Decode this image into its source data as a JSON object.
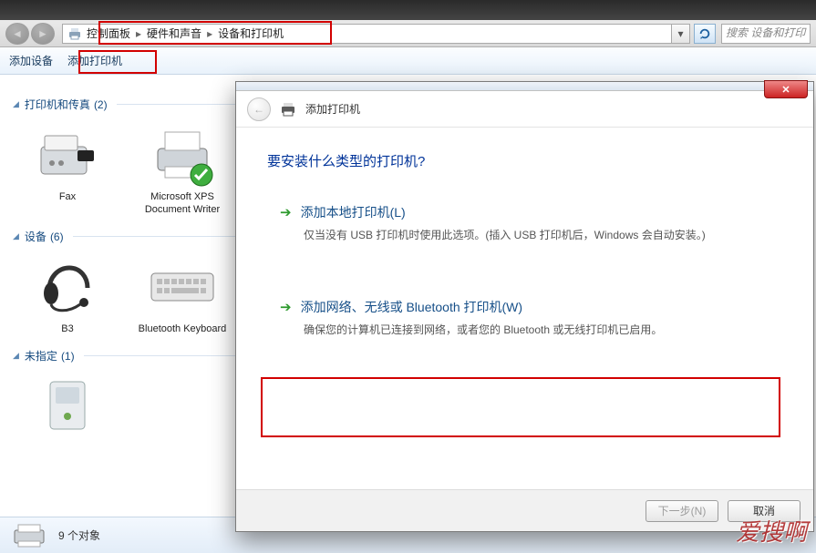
{
  "title_bar": "",
  "breadcrumb": {
    "items": [
      "控制面板",
      "硬件和声音",
      "设备和打印机"
    ]
  },
  "search": {
    "placeholder": "搜索 设备和打印"
  },
  "command_bar": {
    "add_device": "添加设备",
    "add_printer": "添加打印机"
  },
  "groups": {
    "printers": {
      "title": "打印机和传真",
      "count": "(2)"
    },
    "devices": {
      "title": "设备",
      "count": "(6)"
    },
    "unspecified": {
      "title": "未指定",
      "count": "(1)"
    }
  },
  "printers_items": [
    {
      "label": "Fax"
    },
    {
      "label": "Microsoft XPS Document Writer"
    }
  ],
  "devices_items": [
    {
      "label": "B3"
    },
    {
      "label": "Bluetooth Keyboard"
    }
  ],
  "status": {
    "count_text": "9 个对象"
  },
  "dialog": {
    "title": "添加打印机",
    "heading": "要安装什么类型的打印机?",
    "opt1_title": "添加本地打印机(L)",
    "opt1_desc": "仅当没有 USB 打印机时使用此选项。(插入 USB 打印机后，Windows 会自动安装。)",
    "opt2_title": "添加网络、无线或 Bluetooth 打印机(W)",
    "opt2_desc": "确保您的计算机已连接到网络，或者您的 Bluetooth 或无线打印机已启用。",
    "next": "下一步(N)",
    "cancel": "取消"
  },
  "watermark": "爱搜啊"
}
